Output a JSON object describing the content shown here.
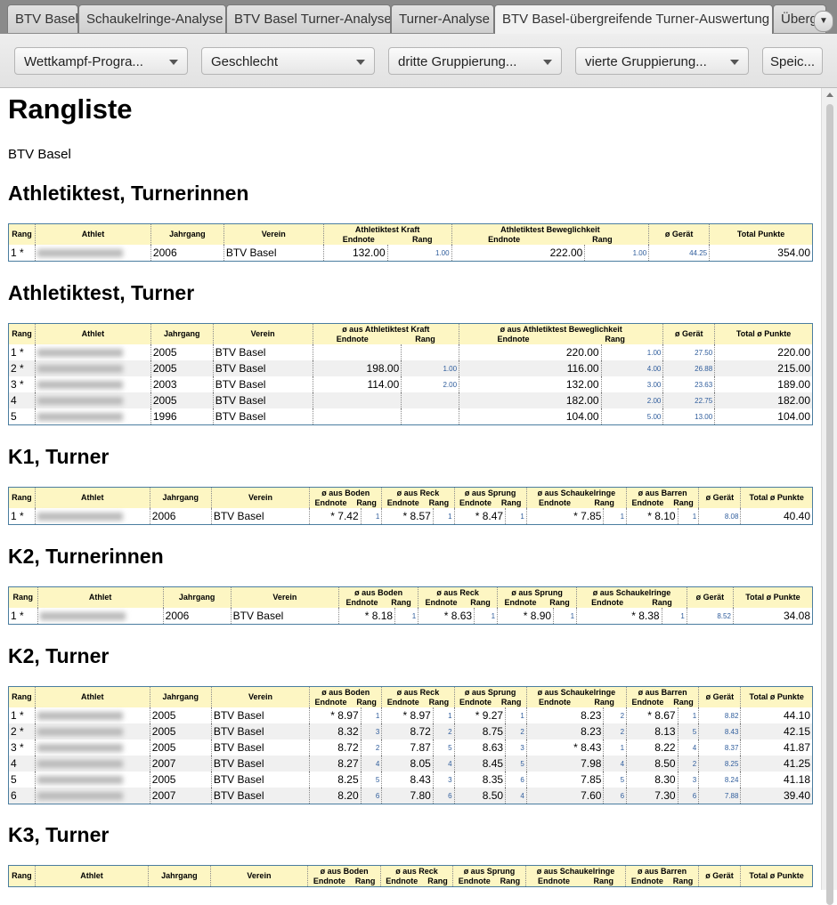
{
  "tabs": [
    {
      "label": "BTV Basel"
    },
    {
      "label": "Schaukelringe-Analyse"
    },
    {
      "label": "BTV Basel Turner-Analyse"
    },
    {
      "label": "Turner-Analyse"
    },
    {
      "label": "BTV Basel-übergreifende Turner-Auswertung"
    },
    {
      "label": "Überg"
    }
  ],
  "toolbar": {
    "dropdowns": [
      {
        "label": "Wettkampf-Progra..."
      },
      {
        "label": "Geschlecht"
      },
      {
        "label": "dritte Gruppierung..."
      },
      {
        "label": "vierte Gruppierung..."
      }
    ],
    "save_label": "Speic..."
  },
  "page": {
    "title": "Rangliste",
    "club": "BTV Basel"
  },
  "headers": {
    "rang": "Rang",
    "athlet": "Athlet",
    "jahrgang": "Jahrgang",
    "verein": "Verein",
    "endnote": "Endnote",
    "rank": "Rang",
    "geraet": "ø Gerät",
    "total": "Total Punkte",
    "total_avg": "Total ø Punkte",
    "kraft": "Athletiktest Kraft",
    "beweg": "Athletiktest Beweglichkeit",
    "avg_kraft": "ø aus Athletiktest Kraft",
    "avg_beweg": "ø aus Athletiktest Beweglichkeit",
    "boden": "ø aus Boden",
    "reck": "ø aus Reck",
    "sprung": "ø aus Sprung",
    "schaukel": "ø aus Schaukelringe",
    "barren": "ø aus Barren"
  },
  "sections": {
    "s1": {
      "title": "Athletiktest, Turnerinnen",
      "rows": [
        {
          "rang": "1 *",
          "jahrgang": "2006",
          "verein": "BTV Basel",
          "a_note": "132.00",
          "a_rang": "1.00",
          "b_note": "222.00",
          "b_rang": "1.00",
          "geraet": "44.25",
          "total": "354.00"
        }
      ]
    },
    "s2": {
      "title": "Athletiktest, Turner",
      "rows": [
        {
          "rang": "1 *",
          "jahrgang": "2005",
          "verein": "BTV Basel",
          "a_note": "",
          "a_rang": "",
          "b_note": "220.00",
          "b_rang": "1.00",
          "geraet": "27.50",
          "total": "220.00"
        },
        {
          "rang": "2 *",
          "jahrgang": "2005",
          "verein": "BTV Basel",
          "a_note": "198.00",
          "a_rang": "1.00",
          "b_note": "116.00",
          "b_rang": "4.00",
          "geraet": "26.88",
          "total": "215.00"
        },
        {
          "rang": "3 *",
          "jahrgang": "2003",
          "verein": "BTV Basel",
          "a_note": "114.00",
          "a_rang": "2.00",
          "b_note": "132.00",
          "b_rang": "3.00",
          "geraet": "23.63",
          "total": "189.00"
        },
        {
          "rang": "4",
          "jahrgang": "2005",
          "verein": "BTV Basel",
          "a_note": "",
          "a_rang": "",
          "b_note": "182.00",
          "b_rang": "2.00",
          "geraet": "22.75",
          "total": "182.00"
        },
        {
          "rang": "5",
          "jahrgang": "1996",
          "verein": "BTV Basel",
          "a_note": "",
          "a_rang": "",
          "b_note": "104.00",
          "b_rang": "5.00",
          "geraet": "13.00",
          "total": "104.00"
        }
      ]
    },
    "s3": {
      "title": "K1, Turner",
      "rows": [
        {
          "rang": "1 *",
          "jahrgang": "2006",
          "verein": "BTV Basel",
          "boden": "* 7.42",
          "boden_r": "1",
          "reck": "* 8.57",
          "reck_r": "1",
          "sprung": "* 8.47",
          "sprung_r": "1",
          "schaukel": "* 7.85",
          "schaukel_r": "1",
          "barren": "* 8.10",
          "barren_r": "1",
          "geraet": "8.08",
          "total": "40.40"
        }
      ]
    },
    "s4": {
      "title": "K2, Turnerinnen",
      "rows": [
        {
          "rang": "1 *",
          "jahrgang": "2006",
          "verein": "BTV Basel",
          "boden": "* 8.18",
          "boden_r": "1",
          "reck": "* 8.63",
          "reck_r": "1",
          "sprung": "* 8.90",
          "sprung_r": "1",
          "schaukel": "* 8.38",
          "schaukel_r": "1",
          "geraet": "8.52",
          "total": "34.08"
        }
      ]
    },
    "s5": {
      "title": "K2, Turner",
      "rows": [
        {
          "rang": "1 *",
          "jahrgang": "2005",
          "verein": "BTV Basel",
          "boden": "* 8.97",
          "boden_r": "1",
          "reck": "* 8.97",
          "reck_r": "1",
          "sprung": "* 9.27",
          "sprung_r": "1",
          "schaukel": "8.23",
          "schaukel_r": "2",
          "barren": "* 8.67",
          "barren_r": "1",
          "geraet": "8.82",
          "total": "44.10"
        },
        {
          "rang": "2 *",
          "jahrgang": "2005",
          "verein": "BTV Basel",
          "boden": "8.32",
          "boden_r": "3",
          "reck": "8.72",
          "reck_r": "2",
          "sprung": "8.75",
          "sprung_r": "2",
          "schaukel": "8.23",
          "schaukel_r": "2",
          "barren": "8.13",
          "barren_r": "5",
          "geraet": "8.43",
          "total": "42.15"
        },
        {
          "rang": "3 *",
          "jahrgang": "2005",
          "verein": "BTV Basel",
          "boden": "8.72",
          "boden_r": "2",
          "reck": "7.87",
          "reck_r": "5",
          "sprung": "8.63",
          "sprung_r": "3",
          "schaukel": "* 8.43",
          "schaukel_r": "1",
          "barren": "8.22",
          "barren_r": "4",
          "geraet": "8.37",
          "total": "41.87"
        },
        {
          "rang": "4",
          "jahrgang": "2007",
          "verein": "BTV Basel",
          "boden": "8.27",
          "boden_r": "4",
          "reck": "8.05",
          "reck_r": "4",
          "sprung": "8.45",
          "sprung_r": "5",
          "schaukel": "7.98",
          "schaukel_r": "4",
          "barren": "8.50",
          "barren_r": "2",
          "geraet": "8.25",
          "total": "41.25"
        },
        {
          "rang": "5",
          "jahrgang": "2005",
          "verein": "BTV Basel",
          "boden": "8.25",
          "boden_r": "5",
          "reck": "8.43",
          "reck_r": "3",
          "sprung": "8.35",
          "sprung_r": "6",
          "schaukel": "7.85",
          "schaukel_r": "5",
          "barren": "8.30",
          "barren_r": "3",
          "geraet": "8.24",
          "total": "41.18"
        },
        {
          "rang": "6",
          "jahrgang": "2007",
          "verein": "BTV Basel",
          "boden": "8.20",
          "boden_r": "6",
          "reck": "7.80",
          "reck_r": "6",
          "sprung": "8.50",
          "sprung_r": "4",
          "schaukel": "7.60",
          "schaukel_r": "6",
          "barren": "7.30",
          "barren_r": "6",
          "geraet": "7.88",
          "total": "39.40"
        }
      ]
    },
    "s6": {
      "title": "K3, Turner",
      "rows": []
    }
  }
}
